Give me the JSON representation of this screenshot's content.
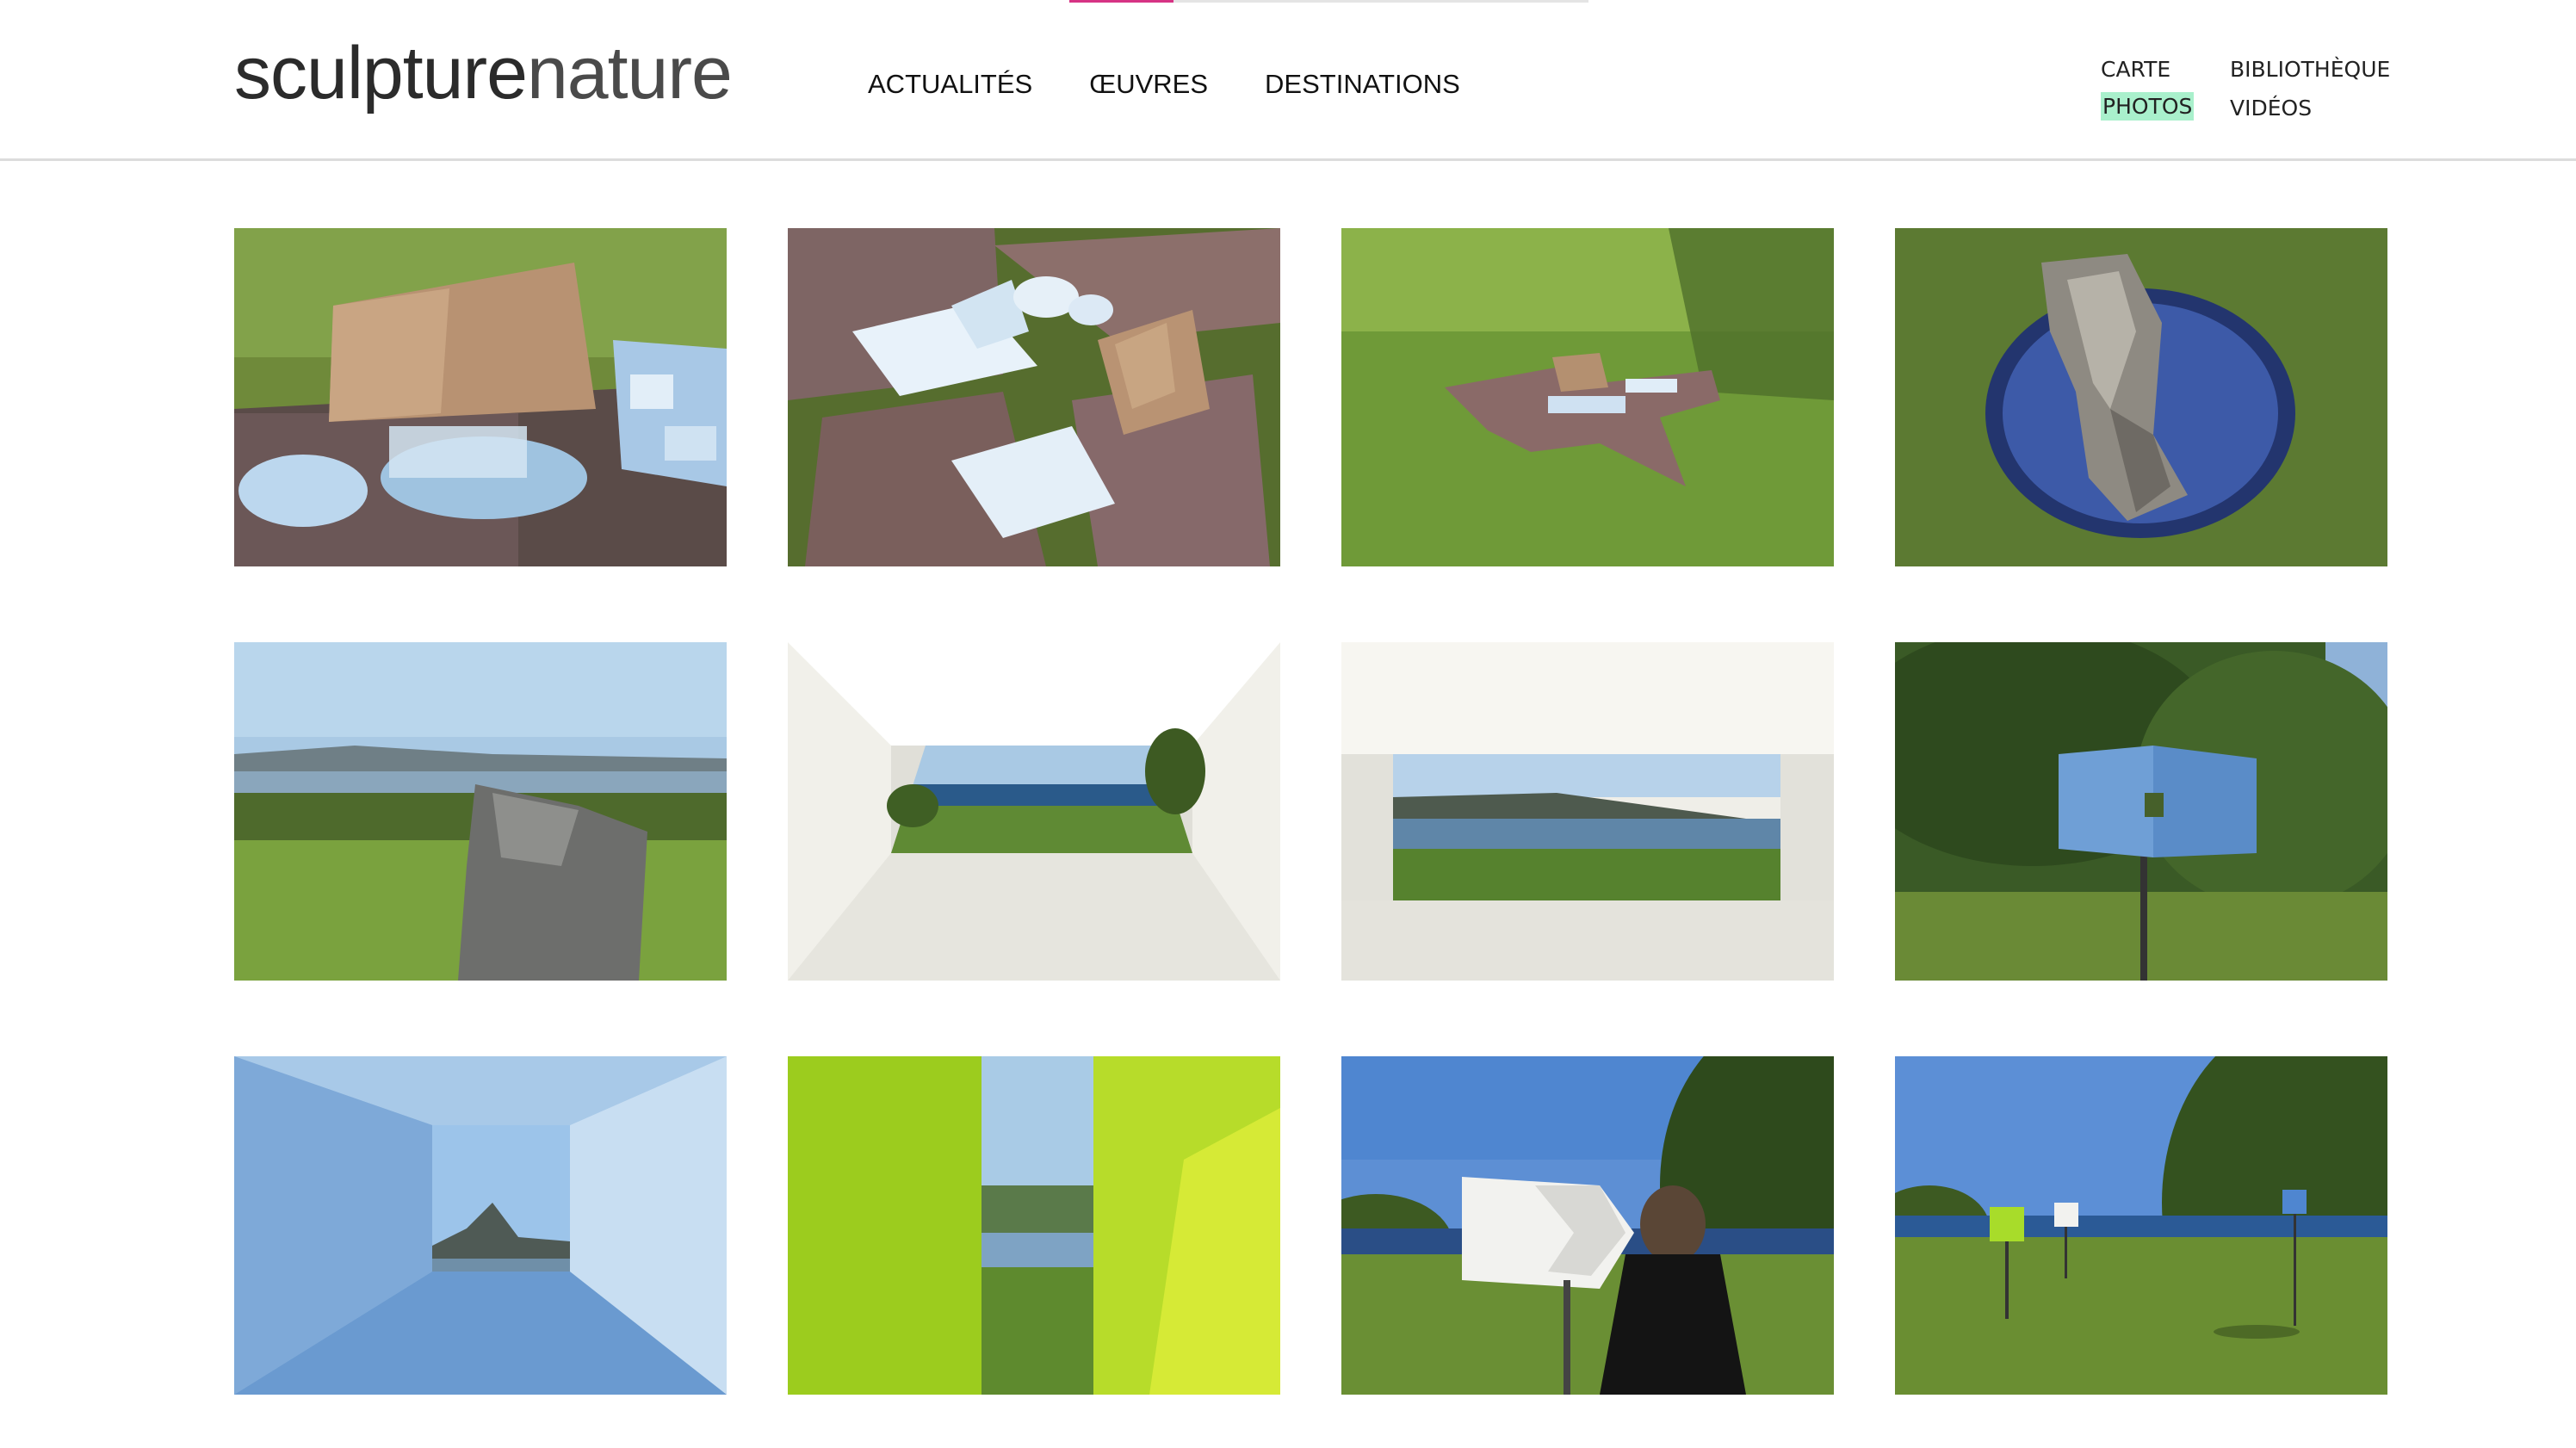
{
  "header": {
    "logo": {
      "part1": "sculpture",
      "part2": "nature"
    },
    "page_progress_percent": 20,
    "main_nav": [
      {
        "label": "ACTUALITÉS"
      },
      {
        "label": "ŒUVRES"
      },
      {
        "label": "DESTINATIONS"
      }
    ],
    "sub_nav": [
      {
        "label": "CARTE"
      },
      {
        "label": "BIBLIOTHÈQUE"
      },
      {
        "label": "PHOTOS",
        "active": true
      },
      {
        "label": "VIDÉOS"
      }
    ]
  },
  "colors": {
    "accent": "#d63384",
    "active_highlight": "#a9f0cc",
    "header_border": "#dcdcdc"
  },
  "gallery": {
    "photos": [
      {
        "subject": "stone-and-mirrors-on-slab-closeup"
      },
      {
        "subject": "slabs-with-mirrors-top-view"
      },
      {
        "subject": "slab-sculpture-on-lawn"
      },
      {
        "subject": "rock-on-round-mirror"
      },
      {
        "subject": "rock-with-bay-view"
      },
      {
        "subject": "white-frame-sea-view"
      },
      {
        "subject": "white-frame-bay-view"
      },
      {
        "subject": "blue-box-on-pole"
      },
      {
        "subject": "blue-box-interior-mountain-view"
      },
      {
        "subject": "green-panels-sea-view"
      },
      {
        "subject": "visitor-at-white-frame"
      },
      {
        "subject": "three-boxes-in-meadow"
      }
    ]
  }
}
